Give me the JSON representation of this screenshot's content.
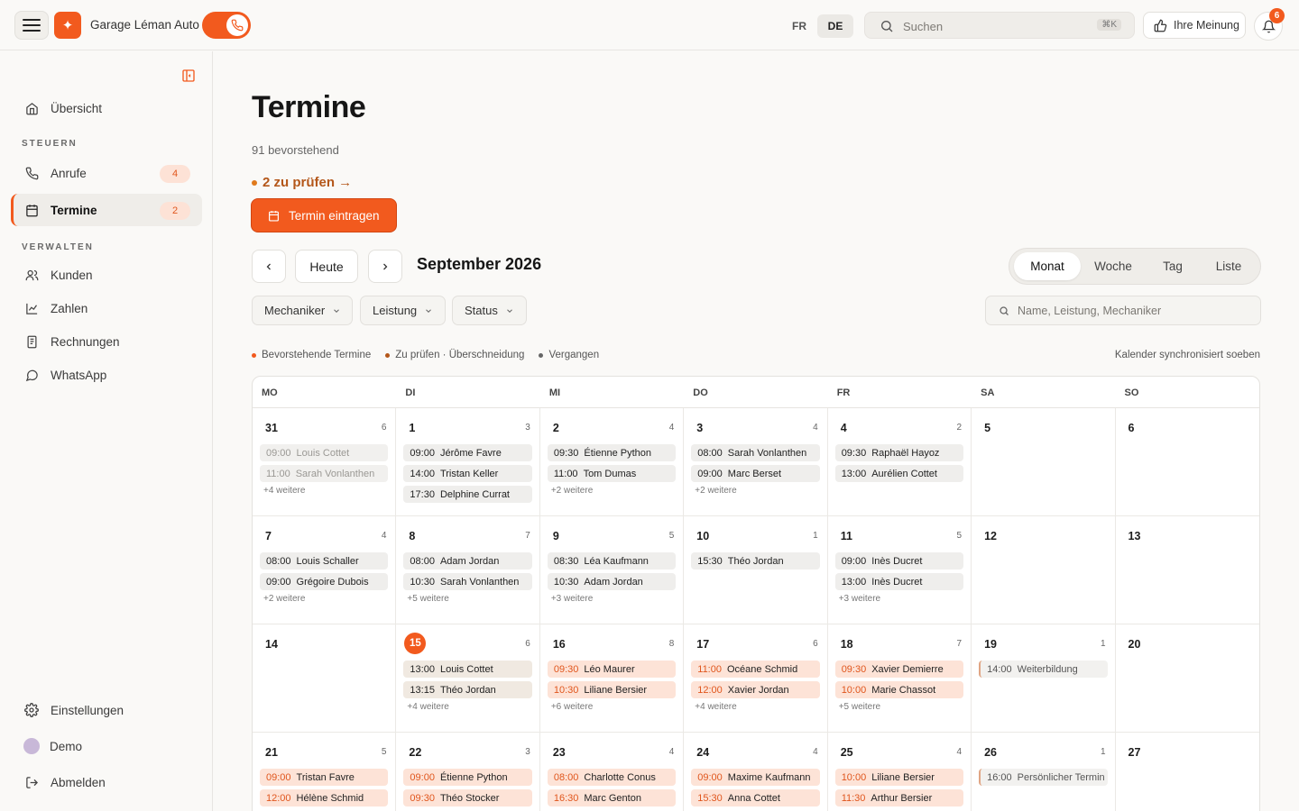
{
  "topbar": {
    "brand": "Garage Léman Auto",
    "lang_fr": "FR",
    "lang_de": "DE",
    "search_placeholder": "Suchen",
    "search_kbd": "⌘K",
    "feedback_label": "Ihre Meinung",
    "notification_count": "6"
  },
  "sidebar": {
    "overview": "Übersicht",
    "section_steuern": "STEUERN",
    "calls": "Anrufe",
    "calls_count": "4",
    "appointments": "Termine",
    "appointments_count": "2",
    "section_verwalten": "VERWALTEN",
    "customers": "Kunden",
    "numbers": "Zahlen",
    "invoices": "Rechnungen",
    "whatsapp": "WhatsApp",
    "settings": "Einstellungen",
    "demo": "Demo",
    "logout": "Abmelden"
  },
  "main": {
    "title": "Termine",
    "subtitle": "91 bevorstehend",
    "review_link": "2 zu prüfen →",
    "cta": "Termin eintragen",
    "today": "Heute",
    "month": "September 2026",
    "views": [
      "Monat",
      "Woche",
      "Tag",
      "Liste"
    ],
    "filters": [
      "Mechaniker",
      "Leistung",
      "Status"
    ],
    "search_placeholder": "Name, Leistung, Mechaniker",
    "legend": [
      "Bevorstehende Termine",
      "Zu prüfen · Überschneidung",
      "Vergangen"
    ],
    "sync_status": "Kalender synchronisiert soeben"
  },
  "colors": {
    "accent": "#f25a1e",
    "review": "#b4571a",
    "past": "#9a9894"
  },
  "calendar": {
    "weekdays": [
      "MO",
      "DI",
      "MI",
      "DO",
      "FR",
      "SA",
      "SO"
    ],
    "weeks": [
      [
        {
          "day": "31",
          "count": "6",
          "events": [
            [
              "09:00",
              "Louis Cottet",
              "past"
            ],
            [
              "11:00",
              "Sarah Vonlanthen",
              "past"
            ]
          ],
          "more": "+4 weitere"
        },
        {
          "day": "1",
          "count": "3",
          "events": [
            [
              "09:00",
              "Jérôme Favre",
              "soon"
            ],
            [
              "14:00",
              "Tristan Keller",
              "soon"
            ],
            [
              "17:30",
              "Delphine Currat",
              "soon"
            ]
          ],
          "more": ""
        },
        {
          "day": "2",
          "count": "4",
          "events": [
            [
              "09:30",
              "Étienne Python",
              "soon"
            ],
            [
              "11:00",
              "Tom Dumas",
              "soon"
            ]
          ],
          "more": "+2 weitere"
        },
        {
          "day": "3",
          "count": "4",
          "events": [
            [
              "08:00",
              "Sarah Vonlanthen",
              "soon"
            ],
            [
              "09:00",
              "Marc Berset",
              "soon"
            ]
          ],
          "more": "+2 weitere"
        },
        {
          "day": "4",
          "count": "2",
          "events": [
            [
              "09:30",
              "Raphaël Hayoz",
              "soon"
            ],
            [
              "13:00",
              "Aurélien Cottet",
              "soon"
            ]
          ],
          "more": ""
        },
        {
          "day": "5",
          "count": "",
          "events": [],
          "more": ""
        },
        {
          "day": "6",
          "count": "",
          "events": [],
          "more": ""
        }
      ],
      [
        {
          "day": "7",
          "count": "4",
          "events": [
            [
              "08:00",
              "Louis Schaller",
              "soon"
            ],
            [
              "09:00",
              "Grégoire Dubois",
              "soon"
            ]
          ],
          "more": "+2 weitere"
        },
        {
          "day": "8",
          "count": "7",
          "events": [
            [
              "08:00",
              "Adam Jordan",
              "soon"
            ],
            [
              "10:30",
              "Sarah Vonlanthen",
              "soon"
            ]
          ],
          "more": "+5 weitere"
        },
        {
          "day": "9",
          "count": "5",
          "events": [
            [
              "08:30",
              "Léa Kaufmann",
              "soon"
            ],
            [
              "10:30",
              "Adam Jordan",
              "soon"
            ]
          ],
          "more": "+3 weitere"
        },
        {
          "day": "10",
          "count": "1",
          "events": [
            [
              "15:30",
              "Théo Jordan",
              "soon"
            ]
          ],
          "more": ""
        },
        {
          "day": "11",
          "count": "5",
          "events": [
            [
              "09:00",
              "Inès Ducret",
              "soon"
            ],
            [
              "13:00",
              "Inès Ducret",
              "soon"
            ]
          ],
          "more": "+3 weitere"
        },
        {
          "day": "12",
          "count": "",
          "events": [],
          "more": ""
        },
        {
          "day": "13",
          "count": "",
          "events": [],
          "more": ""
        }
      ],
      [
        {
          "day": "14",
          "count": "",
          "events": [],
          "more": ""
        },
        {
          "day": "15",
          "count": "6",
          "today": true,
          "events": [
            [
              "13:00",
              "Louis Cottet",
              "review"
            ],
            [
              "13:15",
              "Théo Jordan",
              "review"
            ]
          ],
          "more": "+4 weitere"
        },
        {
          "day": "16",
          "count": "8",
          "events": [
            [
              "09:30",
              "Léo Maurer",
              "upc"
            ],
            [
              "10:30",
              "Liliane Bersier",
              "upc"
            ]
          ],
          "more": "+6 weitere"
        },
        {
          "day": "17",
          "count": "6",
          "events": [
            [
              "11:00",
              "Océane Schmid",
              "upc"
            ],
            [
              "12:00",
              "Xavier Jordan",
              "upc"
            ]
          ],
          "more": "+4 weitere"
        },
        {
          "day": "18",
          "count": "7",
          "events": [
            [
              "09:30",
              "Xavier Demierre",
              "upc"
            ],
            [
              "10:00",
              "Marie Chassot",
              "upc"
            ]
          ],
          "more": "+5 weitere"
        },
        {
          "day": "19",
          "count": "1",
          "events": [
            [
              "14:00",
              "Weiterbildung",
              "personal"
            ]
          ],
          "more": ""
        },
        {
          "day": "20",
          "count": "",
          "events": [],
          "more": ""
        }
      ],
      [
        {
          "day": "21",
          "count": "5",
          "events": [
            [
              "09:00",
              "Tristan Favre",
              "upc"
            ],
            [
              "12:00",
              "Hélène Schmid",
              "upc"
            ]
          ],
          "more": ""
        },
        {
          "day": "22",
          "count": "3",
          "events": [
            [
              "09:00",
              "Étienne Python",
              "upc"
            ],
            [
              "09:30",
              "Théo Stocker",
              "upc"
            ]
          ],
          "more": ""
        },
        {
          "day": "23",
          "count": "4",
          "events": [
            [
              "08:00",
              "Charlotte Conus",
              "upc"
            ],
            [
              "16:30",
              "Marc Genton",
              "upc"
            ]
          ],
          "more": ""
        },
        {
          "day": "24",
          "count": "4",
          "events": [
            [
              "09:00",
              "Maxime Kaufmann",
              "upc"
            ],
            [
              "15:30",
              "Anna Cottet",
              "upc"
            ]
          ],
          "more": ""
        },
        {
          "day": "25",
          "count": "4",
          "events": [
            [
              "10:00",
              "Liliane Bersier",
              "upc"
            ],
            [
              "11:30",
              "Arthur Bersier",
              "upc"
            ]
          ],
          "more": ""
        },
        {
          "day": "26",
          "count": "1",
          "events": [
            [
              "16:00",
              "Persönlicher Termin",
              "personal"
            ]
          ],
          "more": ""
        },
        {
          "day": "27",
          "count": "",
          "events": [],
          "more": ""
        }
      ]
    ]
  }
}
